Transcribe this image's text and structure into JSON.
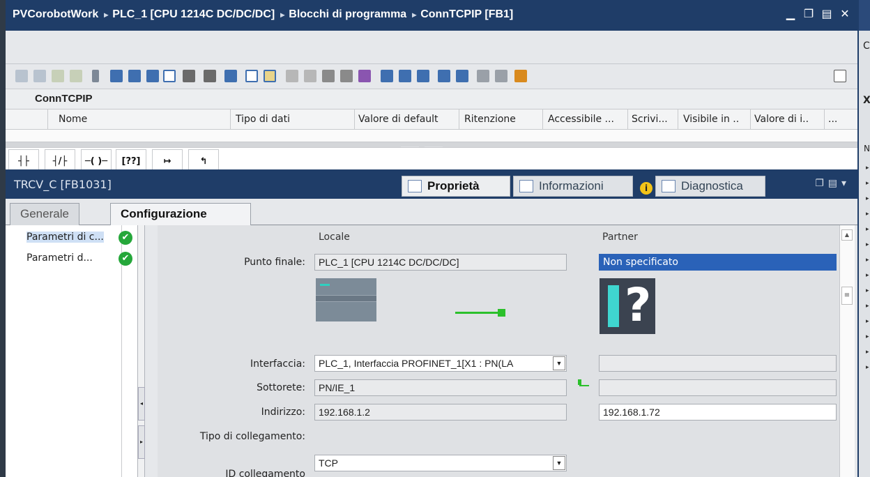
{
  "title_bar": {
    "crumbs": [
      "PVCorobotWork",
      "PLC_1 [CPU 1214C DC/DC/DC]",
      "Blocchi di programma",
      "ConnTCPIP [FB1]"
    ],
    "separator": "▸",
    "ctrl_min": "▁",
    "ctrl_restore": "❐",
    "ctrl_max": "▤",
    "ctrl_close": "✕"
  },
  "right_strip": {
    "letters": [
      "C",
      "X",
      "N"
    ]
  },
  "block_interface": {
    "title": "ConnTCPIP",
    "columns": [
      "Nome",
      "Tipo di dati",
      "Valore di default",
      "Ritenzione",
      "Accessibile ...",
      "Scrivi...",
      "Visibile in ..",
      "Valore di i..",
      "..."
    ]
  },
  "inspector": {
    "object_name": "TRCV_C [FB1031]",
    "tabs": [
      {
        "label": "Proprietà"
      },
      {
        "label": "Informazioni"
      },
      {
        "label": "Diagnostica"
      }
    ],
    "subtabs": [
      "Generale",
      "Configurazione"
    ]
  },
  "nav_tree": {
    "items": [
      "Parametri di c...",
      "Parametri d..."
    ]
  },
  "config": {
    "col_local": "Locale",
    "col_partner": "Partner",
    "labels": {
      "endpoint": "Punto finale:",
      "interface": "Interfaccia:",
      "subnet": "Sottorete:",
      "address": "Indirizzo:",
      "connection_type": "Tipo di collegamento:",
      "connection_id": "ID collegamento"
    },
    "local": {
      "endpoint": "PLC_1 [CPU 1214C DC/DC/DC]",
      "interface": "PLC_1, Interfaccia PROFINET_1[X1 : PN(LA",
      "subnet": "PN/IE_1",
      "address": "192.168.1.2",
      "connection_type": "TCP"
    },
    "partner": {
      "endpoint": "Non specificato",
      "interface": "",
      "subnet": "",
      "address": "192.168.1.72"
    }
  },
  "colors": {
    "title_bar": "#1f3d68",
    "selection": "#2a62b8",
    "ok_green": "#25a73a"
  }
}
